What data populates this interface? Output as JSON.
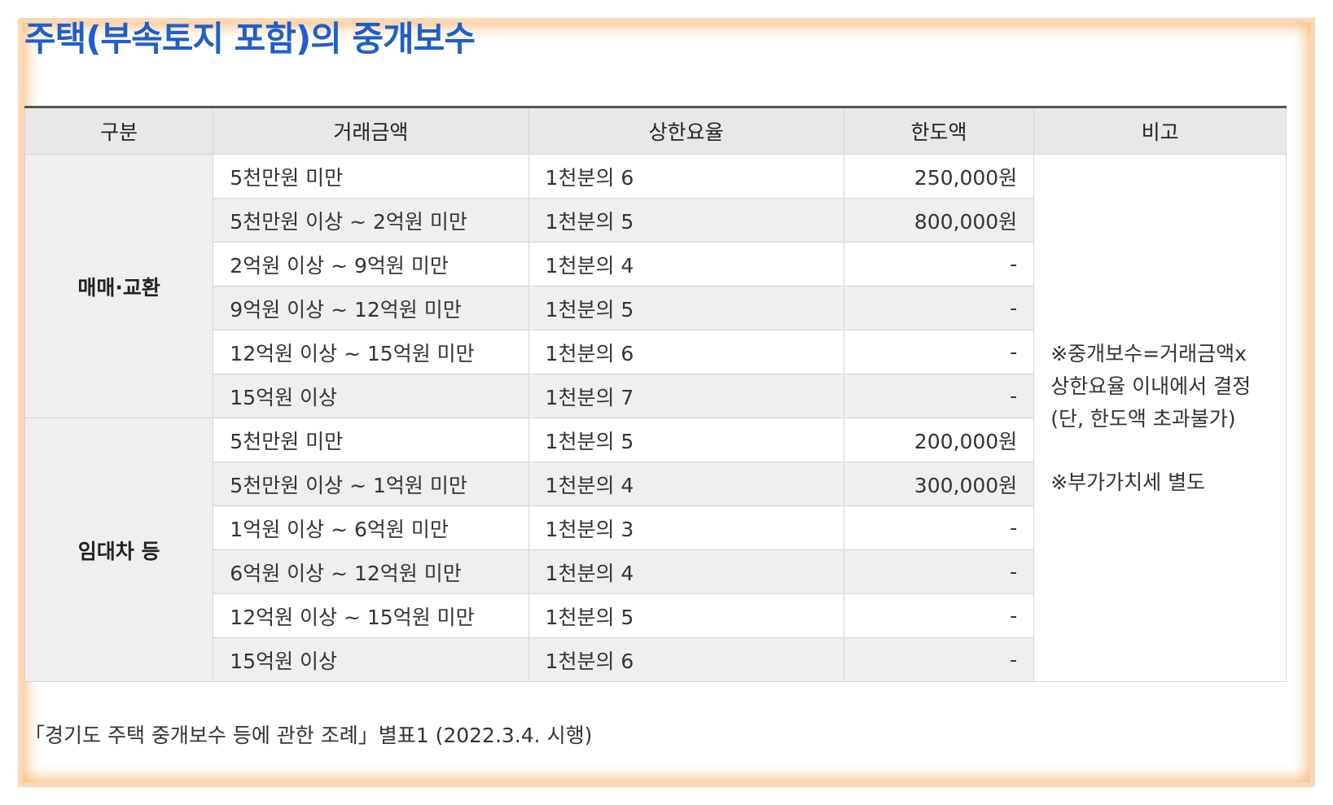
{
  "title": "주택(부속토지 포함)의 중개보수",
  "table": {
    "headers": [
      "구분",
      "거래금액",
      "상한요율",
      "한도액",
      "비고"
    ],
    "groups": [
      {
        "category": "매매·교환",
        "rows": [
          {
            "amount": "5천만원 미만",
            "rate": "1천분의 6",
            "limit": "250,000원"
          },
          {
            "amount": "5천만원 이상 ~ 2억원 미만",
            "rate": "1천분의 5",
            "limit": "800,000원"
          },
          {
            "amount": "2억원 이상 ~ 9억원 미만",
            "rate": "1천분의 4",
            "limit": "-"
          },
          {
            "amount": "9억원 이상 ~ 12억원 미만",
            "rate": "1천분의 5",
            "limit": "-"
          },
          {
            "amount": "12억원 이상 ~ 15억원 미만",
            "rate": "1천분의 6",
            "limit": "-"
          },
          {
            "amount": "15억원 이상",
            "rate": "1천분의 7",
            "limit": "-"
          }
        ]
      },
      {
        "category": "임대차 등",
        "rows": [
          {
            "amount": "5천만원 미만",
            "rate": "1천분의 5",
            "limit": "200,000원"
          },
          {
            "amount": "5천만원 이상 ~ 1억원 미만",
            "rate": "1천분의 4",
            "limit": "300,000원"
          },
          {
            "amount": "1억원 이상 ~ 6억원 미만",
            "rate": "1천분의 3",
            "limit": "-"
          },
          {
            "amount": "6억원 이상 ~ 12억원 미만",
            "rate": "1천분의 4",
            "limit": "-"
          },
          {
            "amount": "12억원 이상 ~ 15억원 미만",
            "rate": "1천분의 5",
            "limit": "-"
          },
          {
            "amount": "15억원 이상",
            "rate": "1천분의 6",
            "limit": "-"
          }
        ]
      }
    ],
    "note": {
      "line1": "※중개보수=거래금액x",
      "line2": "상한요율 이내에서 결정",
      "line3": "(단, 한도액 초과불가)",
      "line4": "※부가가치세 별도"
    }
  },
  "source": "「경기도 주택 중개보수 등에 관한 조례」별표1 (2022.3.4. 시행)"
}
